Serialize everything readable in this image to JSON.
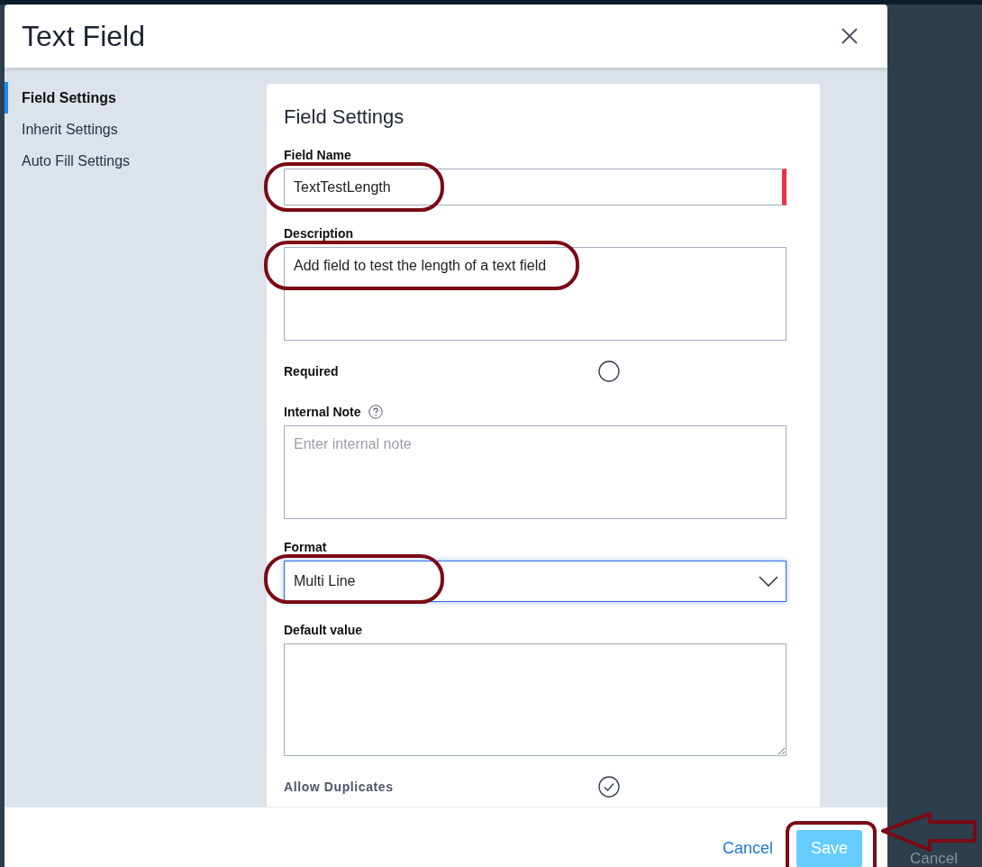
{
  "window": {
    "title": "Text Field"
  },
  "sidebar": {
    "items": [
      {
        "label": "Field Settings",
        "selected": true
      },
      {
        "label": "Inherit Settings",
        "selected": false
      },
      {
        "label": "Auto Fill Settings",
        "selected": false
      }
    ]
  },
  "panel": {
    "title": "Field Settings",
    "fields": [
      {
        "kind": "text",
        "label": "Field Name",
        "value": "TextTestLength",
        "required": true,
        "highlighted": true
      },
      {
        "kind": "textarea",
        "label": "Description",
        "value": "Add field to test the length of a text field",
        "highlighted": true
      },
      {
        "kind": "toggle",
        "label": "Required",
        "checked": false,
        "disabled": false
      },
      {
        "kind": "textarea",
        "label": "Internal Note",
        "help": true,
        "placeholder": "Enter internal note"
      },
      {
        "kind": "select",
        "label": "Format",
        "value": "Multi Line",
        "focused": true,
        "highlighted": true
      },
      {
        "kind": "textarea",
        "label": "Default value",
        "resizable": true
      },
      {
        "kind": "toggle",
        "label": "Allow Duplicates",
        "checked": true,
        "disabled": true
      }
    ]
  },
  "footer": {
    "buttons": [
      {
        "kind": "link",
        "label": "Cancel"
      },
      {
        "kind": "primary",
        "label": "Save",
        "highlighted": true,
        "pointer_arrow": true
      }
    ]
  },
  "background": {
    "text": "Cancel"
  }
}
